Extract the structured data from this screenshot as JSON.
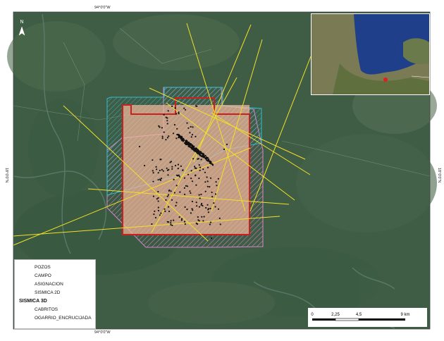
{
  "coords": {
    "top": "94°0'0\"W",
    "bottom": "94°0'0\"W",
    "left": "18°0'0\"N",
    "right": "18°0'0\"N"
  },
  "north_arrow": "N",
  "legend": {
    "pozos": "POZOS",
    "campo": "CAMPO",
    "asignacion": "ASIGNACION",
    "sismica_2d": "SISMICA 2D",
    "sismica_3d_header": "SISMICA 3D",
    "cabritos": "CABRITOS",
    "ogarrio": "OGARRIO_ENCRUCIJADA"
  },
  "scale": {
    "ticks": [
      "0",
      "2,25",
      "4,5",
      "9 km"
    ]
  },
  "colors": {
    "asignacion": "#cc1f1f",
    "campo": "#f4b79a",
    "cabritos": "#33c6e0",
    "ogarrio": "#e58bd8",
    "sismica_2d": "#f3e027",
    "pozos": "#111111"
  }
}
